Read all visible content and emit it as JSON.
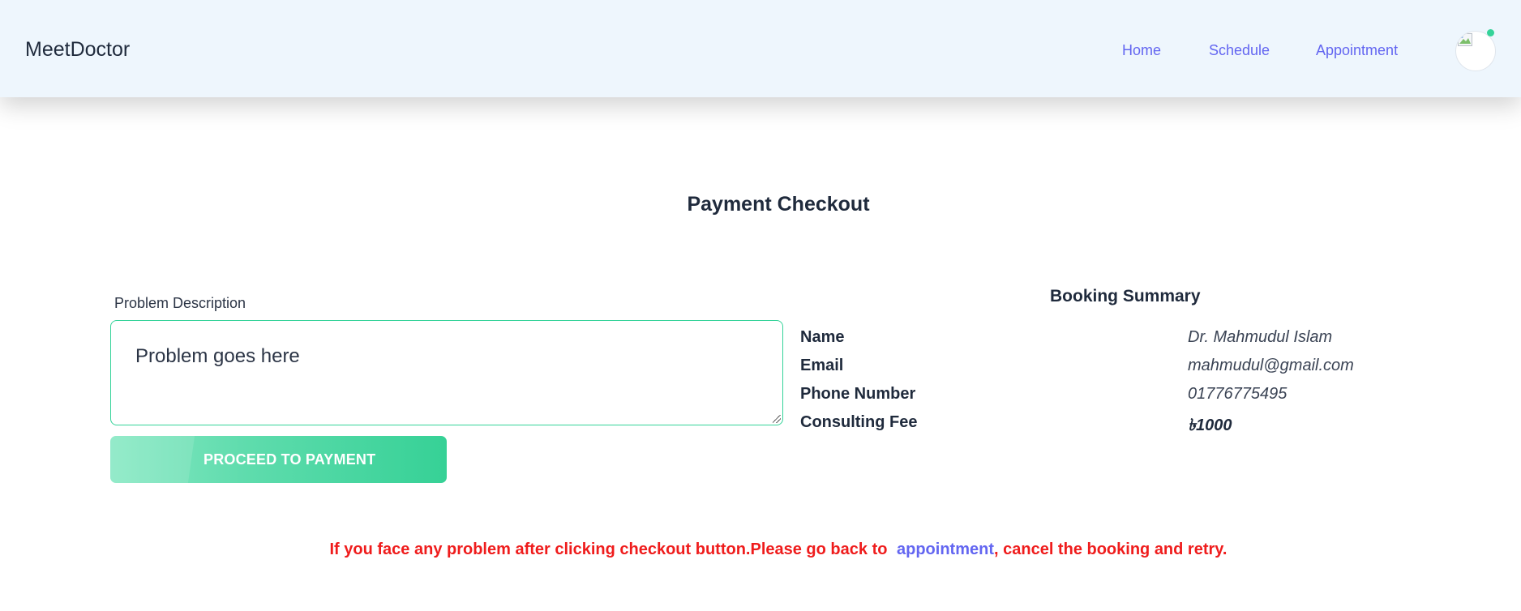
{
  "header": {
    "brand": "MeetDoctor",
    "nav": [
      "Home",
      "Schedule",
      "Appointment"
    ],
    "status_color": "#34d399"
  },
  "main": {
    "title": "Payment Checkout",
    "problem_label": "Problem Description",
    "problem_text": "Problem goes here",
    "proceed_label": "PROCEED TO PAYMENT"
  },
  "summary": {
    "title": "Booking Summary",
    "rows": [
      {
        "label": "Name",
        "value": "Dr. Mahmudul Islam"
      },
      {
        "label": "Email",
        "value": "mahmudul@gmail.com"
      },
      {
        "label": "Phone Number",
        "value": "01776775495"
      },
      {
        "label": "Consulting Fee",
        "value": "৳1000"
      }
    ]
  },
  "notice": {
    "before": "If you face any problem after clicking checkout button.Please go back to ",
    "link": "appointment",
    "after": ", cancel the booking and retry."
  },
  "colors": {
    "accent": "#6366f1",
    "success": "#34d399",
    "warning_text": "#ef1c1c",
    "header_bg": "#eef6fd"
  }
}
